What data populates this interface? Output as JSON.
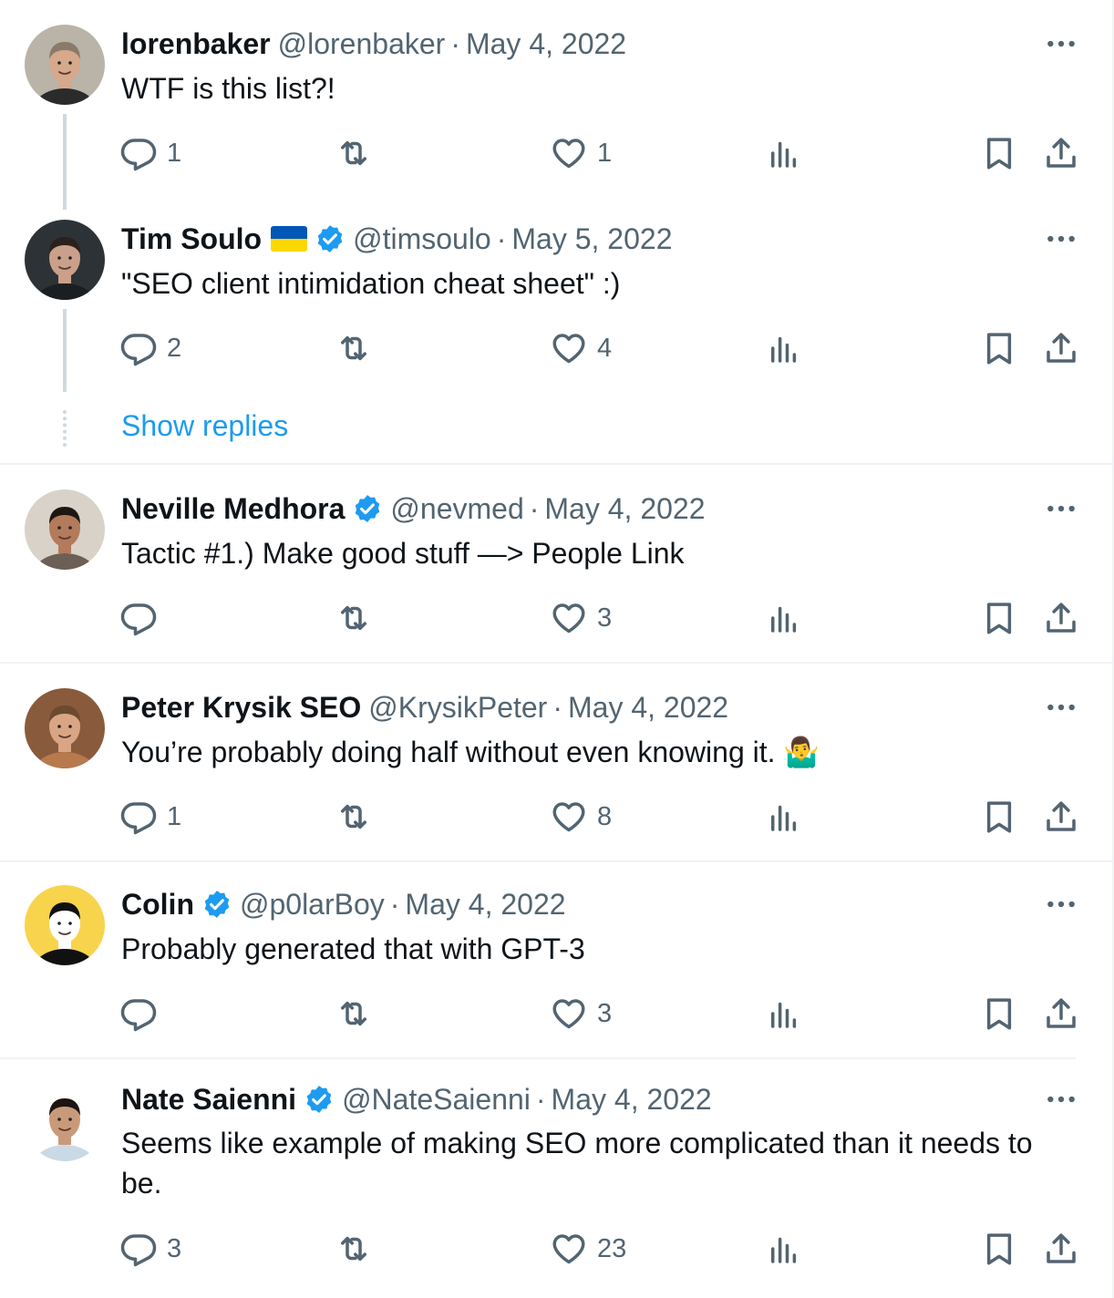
{
  "tweets": [
    {
      "name": "lorenbaker",
      "handle": "@lorenbaker",
      "sep": "·",
      "date": "May 4, 2022",
      "text": "WTF is this list?!",
      "verified": false,
      "flag": false,
      "avatar_colors": {
        "bg": "#b9b3a8",
        "skin": "#d6a88c",
        "shirt": "#2b2b2b",
        "hair": "#8a7a6a"
      },
      "replies": "1",
      "likes": "1"
    },
    {
      "name": "Tim Soulo",
      "handle": "@timsoulo",
      "sep": "·",
      "date": "May 5, 2022",
      "text": "\"SEO client intimidation cheat sheet\" :)",
      "verified": true,
      "flag": true,
      "avatar_colors": {
        "bg": "#2d3236",
        "skin": "#caa08a",
        "shirt": "#1c1f22",
        "hair": "#2a211c"
      },
      "replies": "2",
      "likes": "4"
    },
    {
      "name": "Neville Medhora",
      "handle": "@nevmed",
      "sep": "·",
      "date": "May 4, 2022",
      "text": "Tactic #1.) Make good stuff —> People Link",
      "verified": true,
      "flag": false,
      "avatar_colors": {
        "bg": "#d8d2c8",
        "skin": "#b37a5c",
        "shirt": "#6c5f55",
        "hair": "#1e1612"
      },
      "replies": "",
      "likes": "3"
    },
    {
      "name": "Peter Krysik SEO",
      "handle": "@KrysikPeter",
      "sep": "·",
      "date": "May 4, 2022",
      "text": "You’re probably doing half without even knowing it. 🤷‍♂️",
      "verified": false,
      "flag": false,
      "avatar_colors": {
        "bg": "#8a5a3c",
        "skin": "#d9a585",
        "shirt": "#b87a4c",
        "hair": "#6b4a2e"
      },
      "replies": "1",
      "likes": "8"
    },
    {
      "name": "Colin",
      "handle": "@p0larBoy",
      "sep": "·",
      "date": "May 4, 2022",
      "text": "Probably generated that with GPT-3",
      "verified": true,
      "flag": false,
      "avatar_colors": {
        "bg": "#f7d44c",
        "skin": "#ffffff",
        "shirt": "#111111",
        "hair": "#111111"
      },
      "replies": "",
      "likes": "3"
    },
    {
      "name": "Nate Saienni",
      "handle": "@NateSaienni",
      "sep": "·",
      "date": "May 4, 2022",
      "text": "Seems like example of making SEO more complicated than it needs to be.",
      "verified": true,
      "flag": false,
      "avatar_colors": {
        "bg": "#ffffff",
        "skin": "#c99a7a",
        "shirt": "#c9d9e6",
        "hair": "#1c1410"
      },
      "replies": "3",
      "likes": "23"
    }
  ],
  "show_replies_label": "Show replies",
  "colors": {
    "accent": "#1d9bf0",
    "muted": "#536471",
    "text": "#0f1419",
    "line": "#cfd9de"
  },
  "icons": [
    "reply-icon",
    "retweet-icon",
    "like-icon",
    "views-icon",
    "bookmark-icon",
    "share-icon",
    "more-icon",
    "verified-badge-icon",
    "ukraine-flag-icon"
  ]
}
